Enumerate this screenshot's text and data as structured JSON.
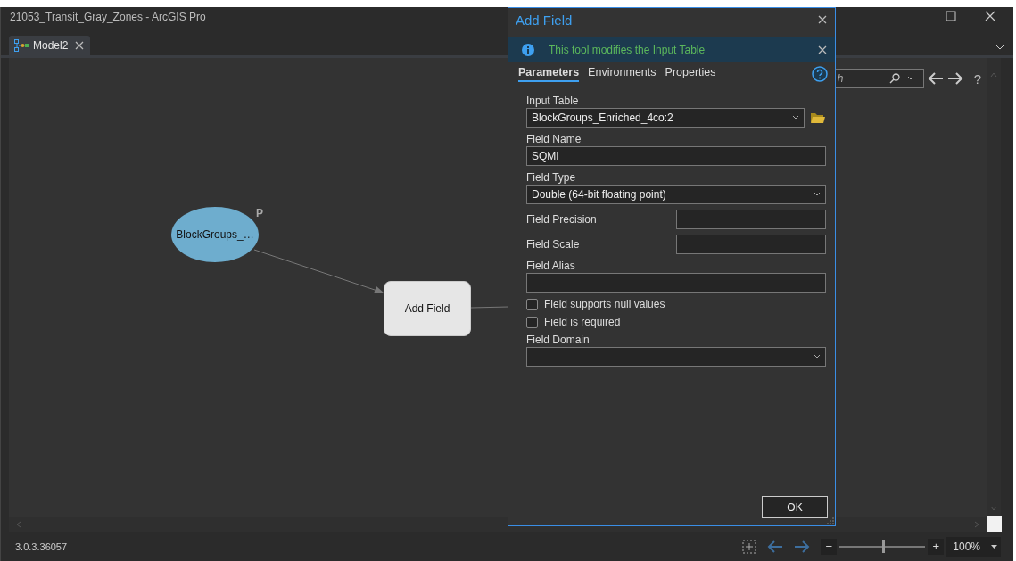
{
  "window": {
    "title": "21053_Transit_Gray_Zones - ArcGIS Pro"
  },
  "tabs": [
    {
      "label": "Model2",
      "selected": true
    }
  ],
  "canvas": {
    "nodes": [
      {
        "kind": "data",
        "label": "BlockGroups_…",
        "badge": "P"
      },
      {
        "kind": "tool",
        "label": "Add Field"
      }
    ]
  },
  "toolbar": {
    "search": {
      "placeholder": "h"
    },
    "help": "?"
  },
  "dialog": {
    "title": "Add Field",
    "message": "This tool modifies the Input Table",
    "tabs": [
      {
        "label": "Parameters",
        "selected": true
      },
      {
        "label": "Environments",
        "selected": false
      },
      {
        "label": "Properties",
        "selected": false
      }
    ],
    "fields": [
      {
        "kind": "dropdown",
        "label": "Input Table",
        "value": "BlockGroups_Enriched_4co:2",
        "browse": true
      },
      {
        "kind": "text",
        "label": "Field Name",
        "value": "SQMI"
      },
      {
        "kind": "dropdown",
        "label": "Field Type",
        "value": "Double (64-bit floating point)"
      },
      {
        "kind": "inline",
        "label": "Field Precision"
      },
      {
        "kind": "inline",
        "label": "Field Scale"
      },
      {
        "kind": "text",
        "label": "Field Alias"
      },
      {
        "kind": "checkbox",
        "label": "Field supports null values",
        "checked": false
      },
      {
        "kind": "checkbox",
        "label": "Field is required",
        "checked": false
      },
      {
        "kind": "dropdown",
        "label": "Field Domain"
      }
    ],
    "button": "OK"
  },
  "status_bar": {
    "version": "3.0.3.36057",
    "zoom_out": "−",
    "zoom_in": "+",
    "zoom": {
      "level": 0.5,
      "value": "100%"
    }
  }
}
